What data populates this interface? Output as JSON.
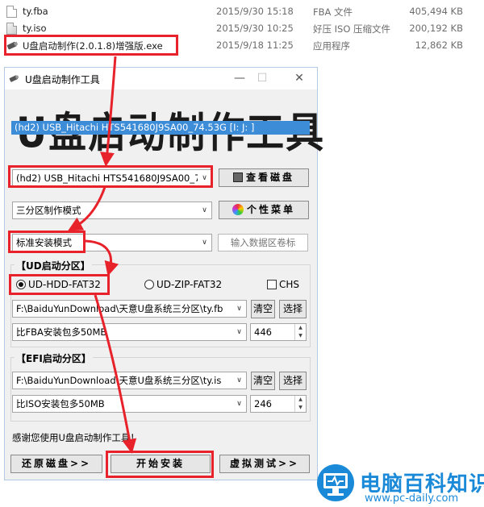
{
  "files": [
    {
      "name": "ty.fba",
      "date": "2015/9/30 15:18",
      "type": "FBA 文件",
      "size": "405,494 KB"
    },
    {
      "name": "ty.iso",
      "date": "2015/9/30 10:25",
      "type": "好压 ISO 压缩文件",
      "size": "200,192 KB"
    },
    {
      "name": "U盘启动制作(2.0.1.8)增强版.exe",
      "date": "2015/9/18 11:25",
      "type": "应用程序",
      "size": "12,862 KB"
    }
  ],
  "window": {
    "title": "U盘启动制作工具",
    "banner": "U盘启动制作工具",
    "minimize": "—",
    "maximize": "☐",
    "close": "✕"
  },
  "disk": {
    "selected": "(hd2) USB_Hitachi HTS541680J9SA00_7",
    "option_highlighted": "(hd2) USB_Hitachi HTS541680J9SA00_74.53G [I: J: ]",
    "view_disk_button": "查看磁盘"
  },
  "partition_mode": {
    "selected": "三分区制作模式",
    "menu_button": "个性菜单"
  },
  "install_mode": {
    "selected": "标准安装模式",
    "label_placeholder": "输入数据区卷标"
  },
  "ud_section": {
    "label": "【UD启动分区】",
    "radio_hdd": "UD-HDD-FAT32",
    "radio_zip": "UD-ZIP-FAT32",
    "chs": "CHS",
    "path": "F:\\BaiduYunDownload\\天意U盘系统三分区\\ty.fb",
    "clear": "清空",
    "choose": "选择",
    "size_option": "比FBA安装包多50MB",
    "size_value": "446"
  },
  "efi_section": {
    "label": "【EFI启动分区】",
    "path": "F:\\BaiduYunDownload\\天意U盘系统三分区\\ty.is",
    "clear": "清空",
    "choose": "选择",
    "size_option": "比ISO安装包多50MB",
    "size_value": "246"
  },
  "status": "感谢您使用U盘启动制作工具！",
  "actions": {
    "restore": "还原磁盘>>",
    "start": "开始安装",
    "test": "虚拟测试>>"
  },
  "watermark": {
    "title": "电脑百科知识",
    "url": "www.pc-daily.com"
  },
  "colors": {
    "highlight_red": "#e8222b",
    "selection_blue": "#3c8cd8",
    "watermark_blue": "#1a8ad8"
  }
}
